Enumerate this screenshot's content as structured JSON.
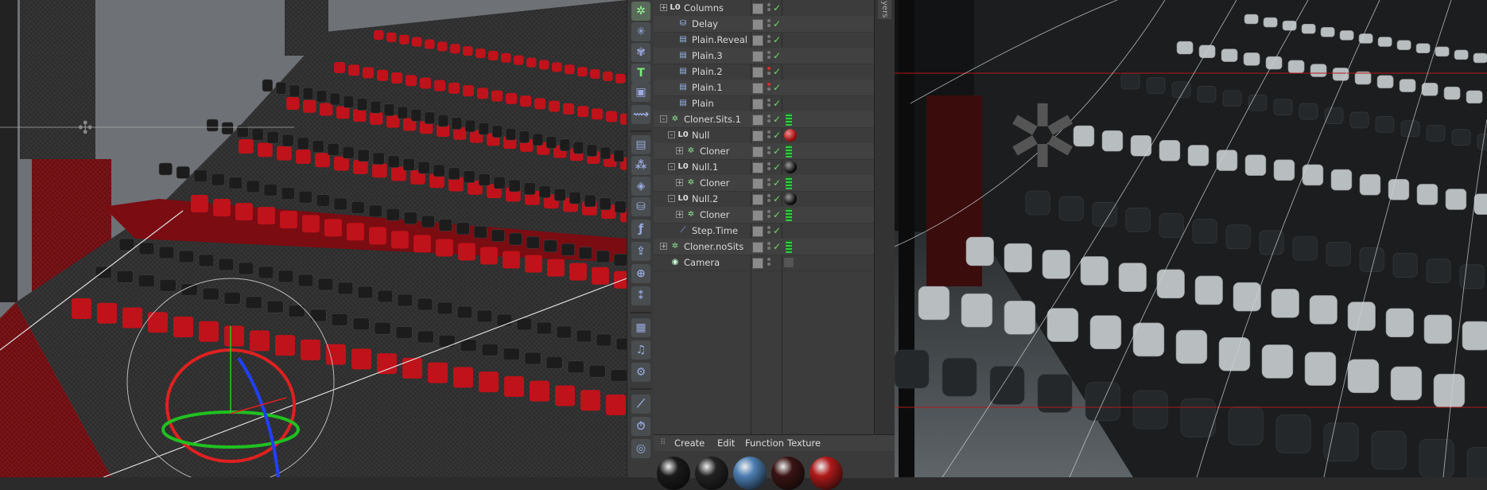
{
  "object_manager": {
    "rows": [
      {
        "name": "Columns",
        "icon": "null-icon",
        "indent": 0,
        "expand": "+",
        "tag": null,
        "vis": "gray"
      },
      {
        "name": "Delay",
        "icon": "effector-icon",
        "indent": 1,
        "expand": null,
        "tag": null,
        "vis": "gray"
      },
      {
        "name": "Plain.Reveal",
        "icon": "plain-effector-icon",
        "indent": 1,
        "expand": null,
        "tag": null,
        "vis": "gray"
      },
      {
        "name": "Plain.3",
        "icon": "plain-effector-icon",
        "indent": 1,
        "expand": null,
        "tag": null,
        "vis": "gray"
      },
      {
        "name": "Plain.2",
        "icon": "plain-effector-icon",
        "indent": 1,
        "expand": null,
        "tag": null,
        "vis": "red"
      },
      {
        "name": "Plain.1",
        "icon": "plain-effector-icon",
        "indent": 1,
        "expand": null,
        "tag": null,
        "vis": "red"
      },
      {
        "name": "Plain",
        "icon": "plain-effector-icon",
        "indent": 1,
        "expand": null,
        "tag": null,
        "vis": "gray"
      },
      {
        "name": "Cloner.Sits.1",
        "icon": "cloner-icon",
        "indent": 0,
        "expand": "-",
        "tag": "green",
        "vis": "gray"
      },
      {
        "name": "Null",
        "icon": "null-icon",
        "indent": 1,
        "expand": "-",
        "tag": "red",
        "vis": "gray"
      },
      {
        "name": "Cloner",
        "icon": "cloner-icon",
        "indent": 2,
        "expand": "+",
        "tag": "green",
        "vis": "gray"
      },
      {
        "name": "Null.1",
        "icon": "null-icon",
        "indent": 1,
        "expand": "-",
        "tag": "black",
        "vis": "gray"
      },
      {
        "name": "Cloner",
        "icon": "cloner-icon",
        "indent": 2,
        "expand": "+",
        "tag": "green",
        "vis": "gray"
      },
      {
        "name": "Null.2",
        "icon": "null-icon",
        "indent": 1,
        "expand": "-",
        "tag": "black",
        "vis": "gray"
      },
      {
        "name": "Cloner",
        "icon": "cloner-icon",
        "indent": 2,
        "expand": "+",
        "tag": "green",
        "vis": "gray"
      },
      {
        "name": "Step.Time",
        "icon": "step-effector-icon",
        "indent": 1,
        "expand": null,
        "tag": null,
        "vis": "gray"
      },
      {
        "name": "Cloner.noSits",
        "icon": "cloner-icon",
        "indent": 0,
        "expand": "+",
        "tag": "green",
        "vis": "gray"
      },
      {
        "name": "Camera",
        "icon": "camera-icon",
        "indent": 0,
        "expand": null,
        "tag": "cam",
        "vis": "gray"
      }
    ],
    "side_tab": "yers"
  },
  "material_manager": {
    "menu": [
      "Create",
      "Edit",
      "Function",
      "Texture"
    ],
    "materials": [
      {
        "name": "black-material",
        "color": "#1a1a1a"
      },
      {
        "name": "black-material-2",
        "color": "#222222"
      },
      {
        "name": "blue-material",
        "color": "#4d7fb3"
      },
      {
        "name": "dark-red-material",
        "color": "#3a1414"
      },
      {
        "name": "red-material",
        "color": "#b01a1a"
      }
    ]
  },
  "toolbar_icons": [
    "cloner-tool-icon",
    "array-tool-icon",
    "fracture-tool-icon",
    "mograph-text-icon",
    "matrix-icon",
    "tracer-icon",
    "effector-plain-icon",
    "effector-random-icon",
    "effector-shader-icon",
    "effector-delay-icon",
    "effector-formula-icon",
    "effector-inherit-icon",
    "effector-push-apart-icon",
    "effector-random-2-icon",
    "effector-volume-icon",
    "effector-sound-icon",
    "effector-python-icon",
    "effector-step-icon",
    "effector-time-icon",
    "effector-target-icon"
  ],
  "colors": {
    "seat_red": "#c0121a",
    "seat_gray": "#b8bdc0",
    "check_green": "#6fd96f"
  }
}
